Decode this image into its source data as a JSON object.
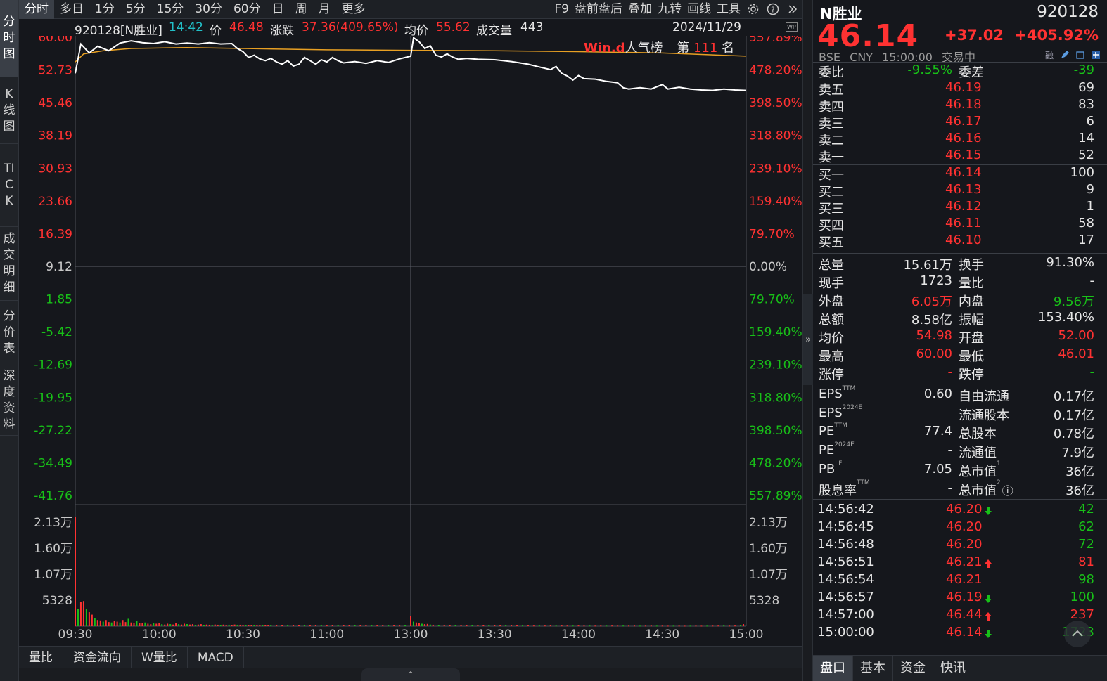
{
  "left_tabs": [
    {
      "label": "分时图",
      "active": true
    },
    {
      "label": "K线图",
      "active": false
    },
    {
      "label": "TICK",
      "active": false
    },
    {
      "label": "成交明细",
      "active": false
    },
    {
      "label": "分价表",
      "active": false
    },
    {
      "label": "深度资料",
      "active": false
    }
  ],
  "toolbar": {
    "periods": [
      "分时",
      "多日",
      "1分",
      "5分",
      "15分",
      "30分",
      "60分",
      "日",
      "周",
      "月",
      "更多"
    ],
    "active_period": "分时",
    "tools": [
      "F9",
      "盘前盘后",
      "叠加",
      "九转",
      "画线",
      "工具"
    ],
    "icons": [
      "gear-icon",
      "help-icon",
      "double-chevron-right-icon"
    ]
  },
  "info": {
    "stock": "920128[N胜业]",
    "time": "14:42",
    "price_label": "价",
    "price": "46.48",
    "change_label": "涨跌",
    "change": "37.36(409.65%)",
    "avg_label": "均价",
    "avg": "55.62",
    "volume_label": "成交量",
    "volume": "443",
    "date": "2024/11/29",
    "badge": "WP"
  },
  "popularity": {
    "brand": "Win.d",
    "label": "人气榜",
    "rank_prefix": "第",
    "rank": "111",
    "rank_suffix": "名"
  },
  "chart_data": {
    "type": "line",
    "title": "",
    "x_ticks": [
      "09:30",
      "10:00",
      "10:30",
      "11:00",
      "13:00",
      "13:30",
      "14:00",
      "14:30",
      "15:00"
    ],
    "price_axis_left": [
      "60.00",
      "52.73",
      "45.46",
      "38.19",
      "30.93",
      "23.66",
      "16.39",
      "9.12",
      "1.85",
      "-5.42",
      "-12.69",
      "-19.95",
      "-27.22",
      "-34.49",
      "-41.76"
    ],
    "pct_axis_right": [
      "557.89%",
      "478.20%",
      "398.50%",
      "318.80%",
      "239.10%",
      "159.40%",
      "79.70%",
      "0.00%",
      "79.70%",
      "159.40%",
      "239.10%",
      "318.80%",
      "398.50%",
      "478.20%",
      "557.89%"
    ],
    "ylim": [
      -41.76,
      60.0
    ],
    "prev_close": 9.12,
    "volume_axis": [
      "2.13万",
      "1.60万",
      "1.07万",
      "5328"
    ],
    "volume_ylim": [
      0,
      26600
    ],
    "series": [
      {
        "name": "价",
        "color": "#ffffff",
        "points": [
          [
            0,
            52.0
          ],
          [
            2,
            58.5
          ],
          [
            5,
            56.5
          ],
          [
            8,
            58.0
          ],
          [
            12,
            57.0
          ],
          [
            16,
            58.7
          ],
          [
            20,
            59.2
          ],
          [
            24,
            58.8
          ],
          [
            28,
            58.6
          ],
          [
            32,
            59.0
          ],
          [
            36,
            58.5
          ],
          [
            40,
            58.7
          ],
          [
            44,
            58.5
          ],
          [
            48,
            58.8
          ],
          [
            52,
            58.5
          ],
          [
            56,
            58.6
          ],
          [
            58,
            57.5
          ],
          [
            60,
            56.8
          ],
          [
            62,
            55.5
          ],
          [
            64,
            56.0
          ],
          [
            66,
            55.2
          ],
          [
            68,
            54.8
          ],
          [
            70,
            55.3
          ],
          [
            72,
            54.5
          ],
          [
            74,
            54.0
          ],
          [
            76,
            54.8
          ],
          [
            78,
            53.6
          ],
          [
            80,
            54.0
          ],
          [
            82,
            55.5
          ],
          [
            84,
            54.8
          ],
          [
            86,
            54.0
          ],
          [
            88,
            55.0
          ],
          [
            90,
            54.5
          ],
          [
            92,
            55.5
          ],
          [
            94,
            54.8
          ],
          [
            96,
            54.3
          ],
          [
            100,
            54.6
          ],
          [
            104,
            54.2
          ],
          [
            108,
            54.8
          ],
          [
            112,
            54.4
          ],
          [
            116,
            55.2
          ],
          [
            120,
            55.8
          ],
          [
            121,
            59.9
          ],
          [
            123,
            59.0
          ],
          [
            125,
            57.5
          ],
          [
            127,
            58.1
          ],
          [
            129,
            56.0
          ],
          [
            131,
            55.6
          ],
          [
            133,
            56.3
          ],
          [
            135,
            55.6
          ],
          [
            137,
            55.1
          ],
          [
            140,
            55.3
          ],
          [
            144,
            55.1
          ],
          [
            150,
            55.0
          ],
          [
            156,
            54.6
          ],
          [
            162,
            54.0
          ],
          [
            166,
            53.4
          ],
          [
            170,
            52.8
          ],
          [
            172,
            53.5
          ],
          [
            174,
            52.0
          ],
          [
            176,
            51.4
          ],
          [
            178,
            50.5
          ],
          [
            180,
            51.5
          ],
          [
            182,
            50.8
          ],
          [
            186,
            50.7
          ],
          [
            190,
            50.2
          ],
          [
            194,
            49.9
          ],
          [
            196,
            48.8
          ],
          [
            198,
            48.5
          ],
          [
            202,
            48.8
          ],
          [
            206,
            48.5
          ],
          [
            210,
            49.5
          ],
          [
            212,
            48.5
          ],
          [
            216,
            48.9
          ],
          [
            220,
            48.5
          ],
          [
            224,
            48.3
          ],
          [
            228,
            48.2
          ],
          [
            232,
            48.5
          ],
          [
            236,
            48.3
          ],
          [
            240,
            48.2
          ]
        ]
      },
      {
        "name": "均价",
        "color": "#e8a023",
        "points": [
          [
            0,
            54.5
          ],
          [
            3,
            56.3
          ],
          [
            10,
            57.0
          ],
          [
            20,
            57.5
          ],
          [
            40,
            57.7
          ],
          [
            60,
            57.5
          ],
          [
            90,
            57.2
          ],
          [
            120,
            57.1
          ],
          [
            150,
            57.0
          ],
          [
            180,
            56.8
          ],
          [
            210,
            56.5
          ],
          [
            240,
            55.8
          ]
        ]
      }
    ],
    "volume_bars": [
      [
        0,
        26500
      ],
      [
        1,
        4200
      ],
      [
        2,
        5800
      ],
      [
        3,
        6100
      ],
      [
        4,
        4200
      ],
      [
        5,
        3400
      ],
      [
        6,
        2800
      ],
      [
        7,
        2000
      ],
      [
        8,
        1500
      ],
      [
        9,
        1400
      ],
      [
        10,
        1100
      ],
      [
        11,
        1500
      ],
      [
        12,
        1000
      ],
      [
        13,
        900
      ],
      [
        14,
        1300
      ],
      [
        15,
        1100
      ],
      [
        16,
        900
      ],
      [
        17,
        1500
      ],
      [
        18,
        1000
      ],
      [
        19,
        1800
      ],
      [
        20,
        900
      ],
      [
        21,
        700
      ],
      [
        22,
        1300
      ],
      [
        23,
        800
      ],
      [
        24,
        700
      ],
      [
        25,
        900
      ],
      [
        26,
        600
      ],
      [
        27,
        500
      ],
      [
        28,
        700
      ],
      [
        29,
        600
      ],
      [
        30,
        800
      ],
      [
        31,
        500
      ],
      [
        32,
        400
      ],
      [
        33,
        600
      ],
      [
        34,
        500
      ],
      [
        35,
        400
      ],
      [
        36,
        700
      ],
      [
        37,
        500
      ],
      [
        38,
        400
      ],
      [
        39,
        600
      ],
      [
        40,
        500
      ],
      [
        41,
        400
      ],
      [
        42,
        500
      ],
      [
        43,
        300
      ],
      [
        44,
        400
      ],
      [
        45,
        500
      ],
      [
        46,
        300
      ],
      [
        47,
        400
      ],
      [
        48,
        350
      ],
      [
        49,
        300
      ],
      [
        50,
        400
      ],
      [
        51,
        350
      ],
      [
        52,
        300
      ],
      [
        53,
        380
      ],
      [
        54,
        300
      ],
      [
        55,
        350
      ],
      [
        56,
        300
      ],
      [
        57,
        400
      ],
      [
        58,
        300
      ],
      [
        59,
        350
      ],
      [
        60,
        320
      ],
      [
        61,
        280
      ],
      [
        62,
        300
      ],
      [
        63,
        250
      ],
      [
        64,
        280
      ],
      [
        65,
        260
      ],
      [
        66,
        300
      ],
      [
        67,
        240
      ],
      [
        68,
        260
      ],
      [
        69,
        220
      ],
      [
        70,
        240
      ],
      [
        72,
        220
      ],
      [
        74,
        260
      ],
      [
        76,
        200
      ],
      [
        78,
        220
      ],
      [
        80,
        250
      ],
      [
        82,
        200
      ],
      [
        84,
        220
      ],
      [
        86,
        240
      ],
      [
        88,
        200
      ],
      [
        90,
        220
      ],
      [
        92,
        180
      ],
      [
        94,
        200
      ],
      [
        96,
        220
      ],
      [
        98,
        180
      ],
      [
        100,
        200
      ],
      [
        102,
        170
      ],
      [
        104,
        190
      ],
      [
        106,
        160
      ],
      [
        108,
        180
      ],
      [
        110,
        170
      ],
      [
        112,
        160
      ],
      [
        114,
        170
      ],
      [
        116,
        150
      ],
      [
        118,
        160
      ],
      [
        120,
        2500
      ],
      [
        121,
        1100
      ],
      [
        122,
        900
      ],
      [
        123,
        700
      ],
      [
        124,
        600
      ],
      [
        125,
        500
      ],
      [
        126,
        550
      ],
      [
        127,
        400
      ],
      [
        128,
        350
      ],
      [
        130,
        300
      ],
      [
        132,
        280
      ],
      [
        134,
        260
      ],
      [
        136,
        240
      ],
      [
        138,
        220
      ],
      [
        140,
        200
      ],
      [
        142,
        220
      ],
      [
        144,
        200
      ],
      [
        146,
        190
      ],
      [
        148,
        180
      ],
      [
        150,
        190
      ],
      [
        152,
        170
      ],
      [
        154,
        180
      ],
      [
        156,
        160
      ],
      [
        158,
        170
      ],
      [
        160,
        150
      ],
      [
        162,
        160
      ],
      [
        164,
        140
      ],
      [
        166,
        150
      ],
      [
        168,
        140
      ],
      [
        170,
        160
      ],
      [
        172,
        130
      ],
      [
        174,
        150
      ],
      [
        176,
        140
      ],
      [
        178,
        130
      ],
      [
        180,
        150
      ],
      [
        182,
        130
      ],
      [
        184,
        140
      ],
      [
        186,
        120
      ],
      [
        188,
        130
      ],
      [
        190,
        120
      ],
      [
        192,
        140
      ],
      [
        194,
        120
      ],
      [
        196,
        130
      ],
      [
        198,
        120
      ],
      [
        200,
        130
      ],
      [
        202,
        110
      ],
      [
        204,
        120
      ],
      [
        206,
        130
      ],
      [
        208,
        110
      ],
      [
        210,
        120
      ],
      [
        212,
        100
      ],
      [
        214,
        110
      ],
      [
        216,
        120
      ],
      [
        218,
        100
      ],
      [
        220,
        110
      ],
      [
        222,
        120
      ],
      [
        224,
        100
      ],
      [
        226,
        110
      ],
      [
        228,
        120
      ],
      [
        230,
        130
      ],
      [
        232,
        150
      ],
      [
        234,
        120
      ],
      [
        236,
        140
      ],
      [
        238,
        200
      ],
      [
        239,
        500
      ]
    ],
    "grid": true
  },
  "bottom_tabs": [
    "量比",
    "资金流向",
    "W量比",
    "MACD"
  ],
  "quote": {
    "name": "N胜业",
    "code": "920128",
    "price": "46.14",
    "change": "+37.02",
    "change_pct": "+405.92%",
    "exchange": "BSE",
    "currency": "CNY",
    "time": "15:00:00",
    "status": "交易中",
    "header_icons": [
      "margin-tag-icon",
      "edit-icon",
      "window-icon",
      "add-icon"
    ],
    "margin_tag": "融",
    "weibi_label": "委比",
    "weibi": "-9.55%",
    "weicha_label": "委差",
    "weicha": "-39",
    "sells": [
      {
        "label": "卖五",
        "price": "46.19",
        "vol": "69"
      },
      {
        "label": "卖四",
        "price": "46.18",
        "vol": "83"
      },
      {
        "label": "卖三",
        "price": "46.17",
        "vol": "6"
      },
      {
        "label": "卖二",
        "price": "46.16",
        "vol": "14"
      },
      {
        "label": "卖一",
        "price": "46.15",
        "vol": "52"
      }
    ],
    "buys": [
      {
        "label": "买一",
        "price": "46.14",
        "vol": "100"
      },
      {
        "label": "买二",
        "price": "46.13",
        "vol": "9"
      },
      {
        "label": "买三",
        "price": "46.12",
        "vol": "1"
      },
      {
        "label": "买四",
        "price": "46.11",
        "vol": "58"
      },
      {
        "label": "买五",
        "price": "46.10",
        "vol": "17"
      }
    ],
    "stats": [
      {
        "l1": "总量",
        "v1": "15.61万",
        "c1": "white",
        "l2": "换手",
        "v2": "91.30%",
        "c2": "white"
      },
      {
        "l1": "现手",
        "v1": "1723",
        "c1": "white",
        "l2": "量比",
        "v2": "-",
        "c2": "white"
      },
      {
        "l1": "外盘",
        "v1": "6.05万",
        "c1": "red",
        "l2": "内盘",
        "v2": "9.56万",
        "c2": "green"
      },
      {
        "l1": "总额",
        "v1": "8.58亿",
        "c1": "white",
        "l2": "振幅",
        "v2": "153.40%",
        "c2": "white"
      },
      {
        "l1": "均价",
        "v1": "54.98",
        "c1": "red",
        "l2": "开盘",
        "v2": "52.00",
        "c2": "red"
      },
      {
        "l1": "最高",
        "v1": "60.00",
        "c1": "red",
        "l2": "最低",
        "v2": "46.01",
        "c2": "red"
      },
      {
        "l1": "涨停",
        "v1": "-",
        "c1": "red",
        "l2": "跌停",
        "v2": "-",
        "c2": "green"
      }
    ],
    "fundamentals": [
      {
        "l1": "EPS",
        "s1": "TTM",
        "v1": "0.60",
        "l2": "自由流通",
        "s2": "",
        "v2": "0.17亿"
      },
      {
        "l1": "EPS",
        "s1": "2024E",
        "v1": "",
        "l2": "流通股本",
        "s2": "",
        "v2": "0.17亿"
      },
      {
        "l1": "PE",
        "s1": "TTM",
        "v1": "77.4",
        "l2": "总股本",
        "s2": "",
        "v2": "0.78亿"
      },
      {
        "l1": "PE",
        "s1": "2024E",
        "v1": "-",
        "l2": "流通值",
        "s2": "",
        "v2": "7.9亿"
      },
      {
        "l1": "PB",
        "s1": "LF",
        "v1": "7.05",
        "l2": "总市值",
        "s2": "1",
        "v2": "36亿"
      },
      {
        "l1": "股息率",
        "s1": "TTM",
        "v1": "-",
        "l2": "总市值",
        "s2": "2",
        "v2": "36亿"
      }
    ],
    "ticks": [
      {
        "time": "14:56:42",
        "price": "46.20",
        "dir": "down",
        "vol": "42",
        "vcolor": "green"
      },
      {
        "time": "14:56:45",
        "price": "46.20",
        "dir": "",
        "vol": "62",
        "vcolor": "green"
      },
      {
        "time": "14:56:48",
        "price": "46.20",
        "dir": "",
        "vol": "72",
        "vcolor": "green"
      },
      {
        "time": "14:56:51",
        "price": "46.21",
        "dir": "up",
        "vol": "81",
        "vcolor": "red"
      },
      {
        "time": "14:56:54",
        "price": "46.21",
        "dir": "",
        "vol": "98",
        "vcolor": "green"
      },
      {
        "time": "14:56:57",
        "price": "46.19",
        "dir": "down",
        "vol": "100",
        "vcolor": "green"
      },
      {
        "time": "14:57:00",
        "price": "46.44",
        "dir": "up",
        "vol": "237",
        "vcolor": "red"
      },
      {
        "time": "15:00:00",
        "price": "46.14",
        "dir": "down",
        "vol": "1723",
        "vcolor": "green"
      }
    ],
    "footer_tabs": [
      "盘口",
      "基本",
      "资金",
      "快讯"
    ],
    "active_footer": "盘口"
  }
}
